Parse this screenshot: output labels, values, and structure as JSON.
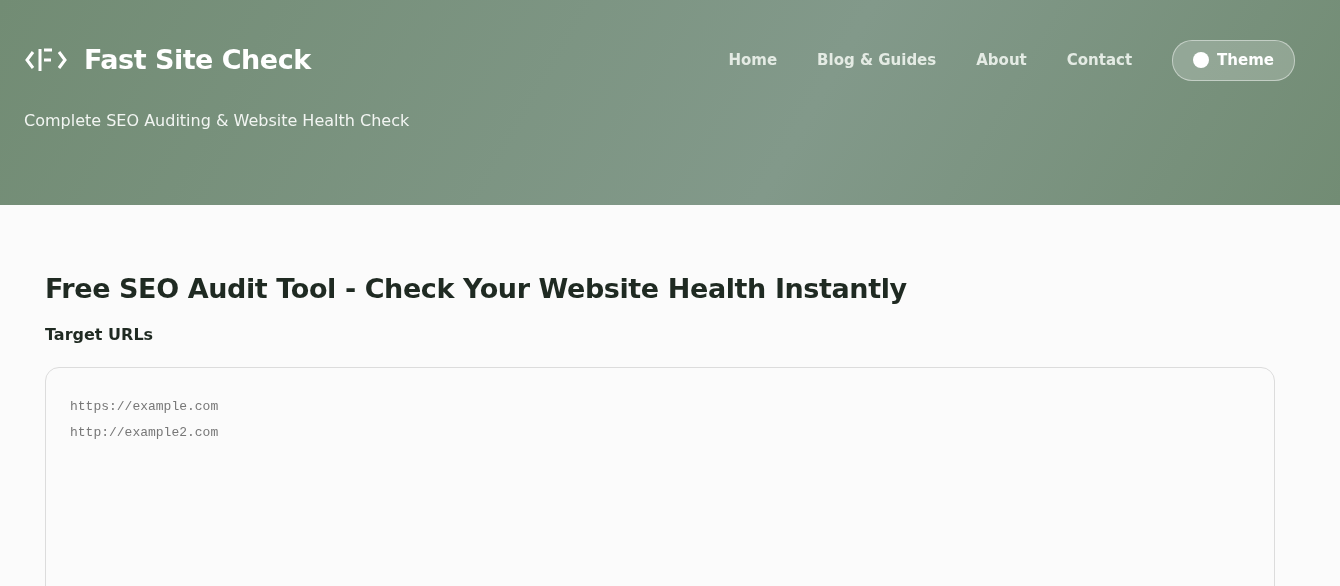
{
  "header": {
    "brand": "Fast Site Check",
    "tagline": "Complete SEO Auditing & Website Health Check",
    "nav": [
      {
        "label": "Home"
      },
      {
        "label": "Blog & Guides"
      },
      {
        "label": "About"
      },
      {
        "label": "Contact"
      }
    ],
    "theme_button": "Theme"
  },
  "main": {
    "heading": "Free SEO Audit Tool - Check Your Website Health Instantly",
    "field_label": "Target URLs",
    "placeholder": "https://example.com\nhttp://example2.com"
  }
}
